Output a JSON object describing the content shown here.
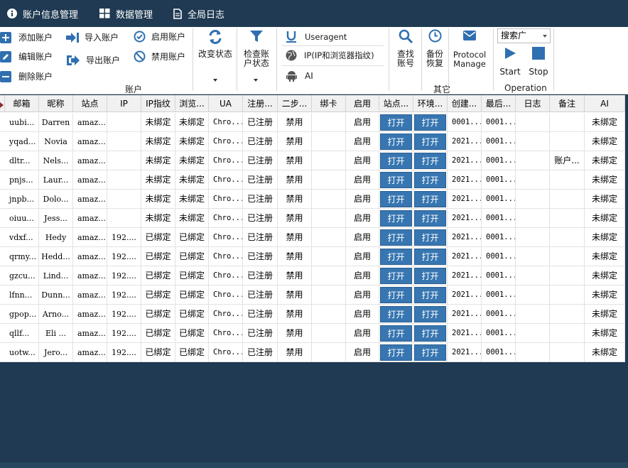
{
  "tabs": [
    {
      "label": "账户信息管理",
      "icon": "info-icon"
    },
    {
      "label": "数据管理",
      "icon": "grid-icon"
    },
    {
      "label": "全局日志",
      "icon": "document-icon"
    }
  ],
  "ribbon": {
    "account": {
      "add": "添加账户",
      "edit": "编辑账户",
      "delete": "删除账户",
      "import": "导入账户",
      "export": "导出账户",
      "enable": "启用账户",
      "disable": "禁用账户",
      "change_status": "改变状态",
      "check_status": "检查账户状态",
      "group_label": "账户"
    },
    "other": {
      "useragent": "Useragent",
      "ip": "IP(IP和浏览器指纹)",
      "ai": "AI",
      "find": "查找账号",
      "backup": "备份恢复",
      "protocol": "Protocol Manage",
      "group_label": "其它"
    },
    "operation": {
      "search_value": "搜索广",
      "start": "Start",
      "stop": "Stop",
      "group_label": "Operation"
    }
  },
  "colors": {
    "dark_bg": "#1f3a52",
    "open_button": "#3776b1"
  },
  "grid": {
    "headers": [
      "邮箱",
      "昵称",
      "站点",
      "IP",
      "IP指纹",
      "浏览...",
      "UA",
      "注册...",
      "二步...",
      "绑卡",
      "启用",
      "站点...",
      "环境...",
      "创建...",
      "最后...",
      "日志",
      "备注",
      "AI"
    ],
    "rows": [
      [
        "uubi...",
        "Darren",
        "amaz...",
        "",
        "未绑定",
        "未绑定",
        "Chro...",
        "已注册",
        "禁用",
        "",
        "启用",
        "打开",
        "打开",
        "0001...",
        "0001...",
        "",
        "",
        "未绑定"
      ],
      [
        "yqad...",
        "Novia",
        "amaz...",
        "",
        "未绑定",
        "未绑定",
        "Chro...",
        "已注册",
        "禁用",
        "",
        "启用",
        "打开",
        "打开",
        "2021...",
        "0001...",
        "",
        "",
        "未绑定"
      ],
      [
        "dltr...",
        "Nels...",
        "amaz...",
        "",
        "未绑定",
        "未绑定",
        "Chro...",
        "已注册",
        "禁用",
        "",
        "启用",
        "打开",
        "打开",
        "2021...",
        "0001...",
        "",
        "账户...",
        "未绑定"
      ],
      [
        "pnjs...",
        "Laur...",
        "amaz...",
        "",
        "未绑定",
        "未绑定",
        "Chro...",
        "已注册",
        "禁用",
        "",
        "启用",
        "打开",
        "打开",
        "2021...",
        "0001...",
        "",
        "",
        "未绑定"
      ],
      [
        "jnpb...",
        "Dolo...",
        "amaz...",
        "",
        "未绑定",
        "未绑定",
        "Chro...",
        "已注册",
        "禁用",
        "",
        "启用",
        "打开",
        "打开",
        "2021...",
        "0001...",
        "",
        "",
        "未绑定"
      ],
      [
        "oiuu...",
        "Jess...",
        "amaz...",
        "",
        "未绑定",
        "未绑定",
        "Chro...",
        "已注册",
        "禁用",
        "",
        "启用",
        "打开",
        "打开",
        "2021...",
        "0001...",
        "",
        "",
        "未绑定"
      ],
      [
        "vdxf...",
        "Hedy",
        "amaz...",
        "192....",
        "已绑定",
        "已绑定",
        "Chro...",
        "已注册",
        "禁用",
        "",
        "启用",
        "打开",
        "打开",
        "2021...",
        "0001...",
        "",
        "",
        "未绑定"
      ],
      [
        "qrmy...",
        "Hedd...",
        "amaz...",
        "192....",
        "已绑定",
        "已绑定",
        "Chro...",
        "已注册",
        "禁用",
        "",
        "启用",
        "打开",
        "打开",
        "2021...",
        "0001...",
        "",
        "",
        "未绑定"
      ],
      [
        "gzcu...",
        "Lind...",
        "amaz...",
        "192....",
        "已绑定",
        "已绑定",
        "Chro...",
        "已注册",
        "禁用",
        "",
        "启用",
        "打开",
        "打开",
        "2021...",
        "0001...",
        "",
        "",
        "未绑定"
      ],
      [
        "lfnn...",
        "Dunn...",
        "amaz...",
        "192....",
        "已绑定",
        "已绑定",
        "Chro...",
        "已注册",
        "禁用",
        "",
        "启用",
        "打开",
        "打开",
        "2021...",
        "0001...",
        "",
        "",
        "未绑定"
      ],
      [
        "gpop...",
        "Arno...",
        "amaz...",
        "192....",
        "已绑定",
        "已绑定",
        "Chro...",
        "已注册",
        "禁用",
        "",
        "启用",
        "打开",
        "打开",
        "2021...",
        "0001...",
        "",
        "",
        "未绑定"
      ],
      [
        "qllf...",
        "Eli ...",
        "amaz...",
        "192....",
        "已绑定",
        "已绑定",
        "Chro...",
        "已注册",
        "禁用",
        "",
        "启用",
        "打开",
        "打开",
        "2021...",
        "0001...",
        "",
        "",
        "未绑定"
      ],
      [
        "uotw...",
        "Jero...",
        "amaz...",
        "192....",
        "已绑定",
        "已绑定",
        "Chro...",
        "已注册",
        "禁用",
        "",
        "启用",
        "打开",
        "打开",
        "2021...",
        "0001...",
        "",
        "",
        "未绑定"
      ]
    ]
  }
}
